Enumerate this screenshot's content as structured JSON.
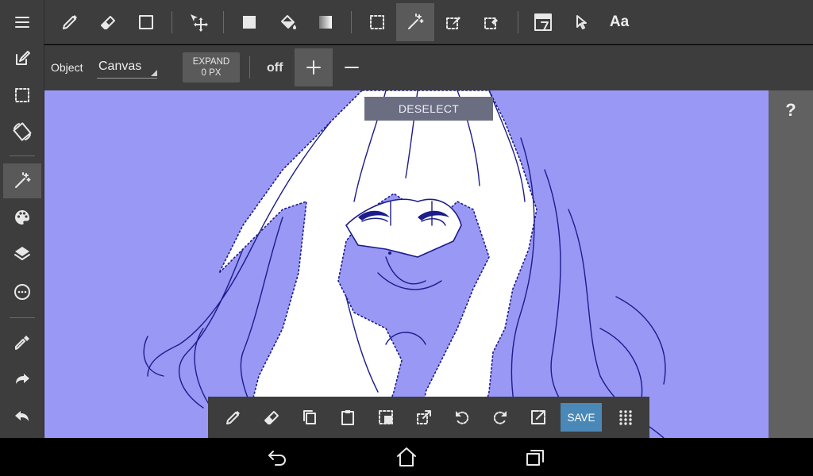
{
  "options": {
    "object_label": "Object",
    "canvas_value": "Canvas",
    "expand_line1": "EXPAND",
    "expand_line2": "0 PX",
    "off_label": "off"
  },
  "canvas": {
    "deselect_label": "DESELECT",
    "background_color": "#9999f5",
    "line_color": "#1c1c8c"
  },
  "right_panel": {
    "help_label": "?"
  },
  "topbar": {
    "text_tool_label": "Aa"
  },
  "bottombar": {
    "save_label": "SAVE"
  },
  "colors": {
    "accent": "#4a88b8",
    "toolbar": "#3d3d3d",
    "active": "#5a5a5a"
  },
  "icons": {
    "sidebar": [
      "menu-icon",
      "edit-icon",
      "selection-icon",
      "rotate-icon",
      "magic-wand-icon",
      "palette-icon",
      "layers-icon",
      "menu-dots-icon",
      "eyedropper-icon",
      "redo-icon",
      "undo-icon"
    ],
    "topbar": [
      "pen-icon",
      "eraser-icon",
      "shape-icon",
      "move-icon",
      "fill-rect-icon",
      "bucket-icon",
      "gradient-icon",
      "select-rect-icon",
      "magic-wand-icon",
      "select-pen-icon",
      "select-eraser-icon",
      "frame-icon",
      "pointer-icon"
    ],
    "bottombar": [
      "pen-icon",
      "eraser-icon",
      "copy-icon",
      "paste-icon",
      "invert-selection-icon",
      "transform-icon",
      "rotate-left-icon",
      "rotate-right-icon",
      "open-external-icon",
      "grid-icon"
    ],
    "nav": [
      "back-icon",
      "home-icon",
      "recents-icon"
    ]
  }
}
